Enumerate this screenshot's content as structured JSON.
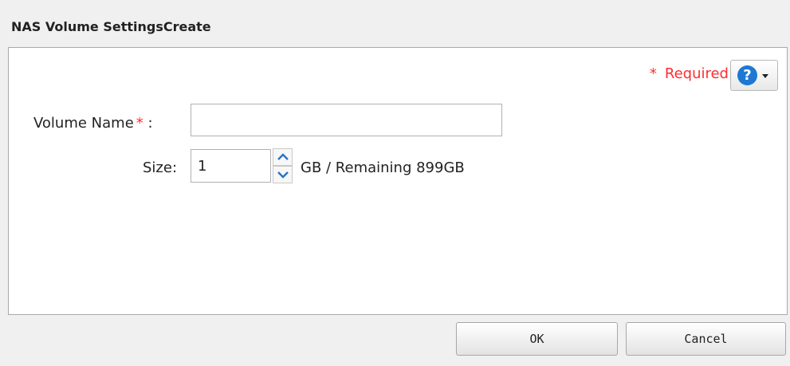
{
  "dialog": {
    "title": "NAS Volume SettingsCreate"
  },
  "required": {
    "star": "*",
    "label": "Required"
  },
  "help": {
    "icon": "question-circle-icon",
    "glyph": "?",
    "icon_color": "#1e78d2"
  },
  "form": {
    "volume_name": {
      "label": "Volume Name",
      "required_star": "*",
      "colon": ":",
      "value": ""
    },
    "size": {
      "label": "Size:",
      "value": "1",
      "remaining_text": "GB / Remaining 899GB"
    }
  },
  "buttons": {
    "ok": "OK",
    "cancel": "Cancel"
  },
  "colors": {
    "required": "#ff2d2d",
    "spinner_arrow": "#2a73c8"
  }
}
